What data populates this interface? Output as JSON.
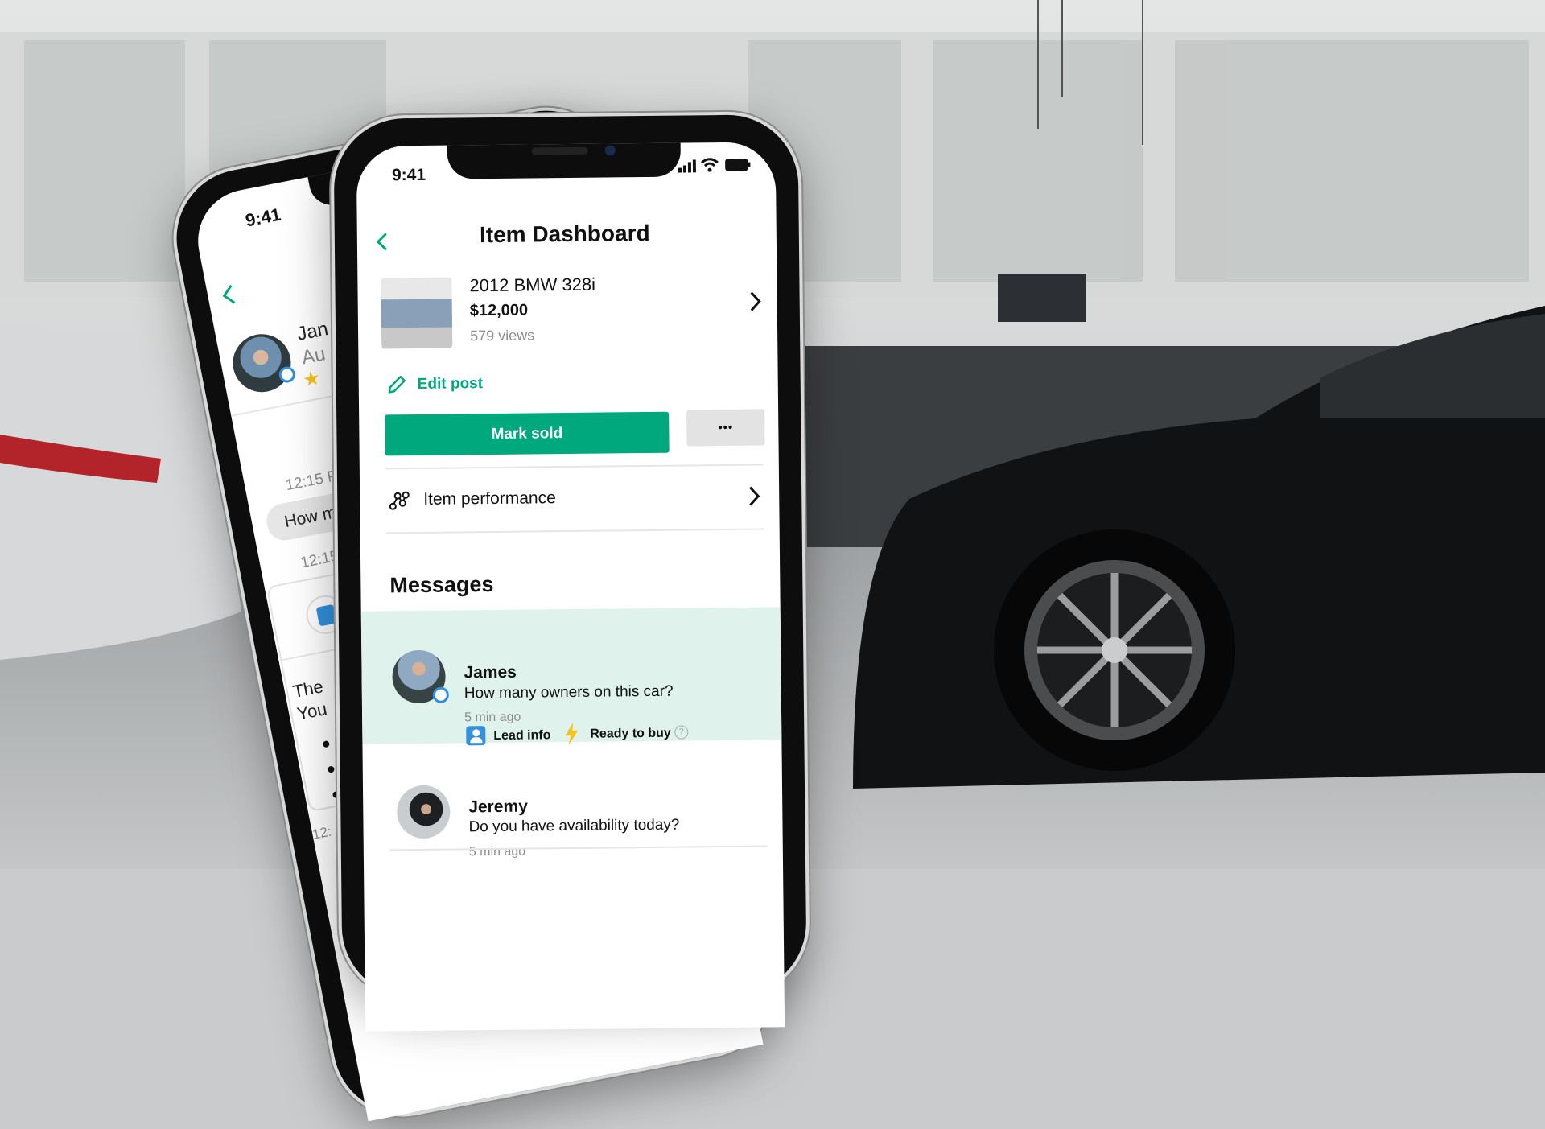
{
  "colors": {
    "accent": "#00a87e",
    "highlight": "#dff2ec",
    "more_button": "#e3e3e3",
    "verified": "#2f8fe0",
    "bolt": "#f6c21c"
  },
  "back_phone": {
    "status_time": "9:41",
    "header_name_partial": "Jan",
    "header_sub_partial": "Au",
    "messages": [
      {
        "time": "12:15 PM",
        "bubble_partial": "How ma"
      },
      {
        "time": "12:15 PM",
        "card_line1_partial": "The",
        "card_line2_partial": "You"
      }
    ],
    "footer_time_partial": "12:"
  },
  "phone": {
    "status_time": "9:41",
    "header": {
      "title": "Item Dashboard",
      "back_icon": "chevron-left-icon"
    },
    "item": {
      "title": "2012 BMW 328i",
      "price": "$12,000",
      "views": "579 views"
    },
    "edit_post": "Edit post",
    "mark_sold": "Mark sold",
    "more": "•••",
    "item_performance": "Item performance",
    "messages_heading": "Messages",
    "messages": [
      {
        "name": "James",
        "text": "How many owners on this car?",
        "time": "5 min ago",
        "verified": true,
        "highlighted": true,
        "lead_info": "Lead info",
        "ready": "Ready to buy",
        "help": "?"
      },
      {
        "name": "Jeremy",
        "text": "Do you have availability today?",
        "time": "5 min ago"
      }
    ]
  }
}
